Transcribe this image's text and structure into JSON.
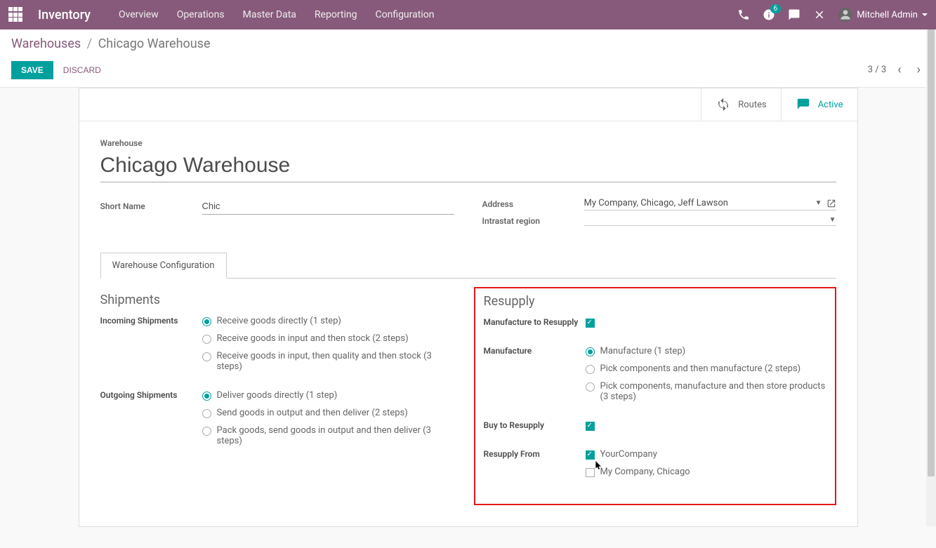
{
  "topbar": {
    "brand": "Inventory",
    "menu": [
      "Overview",
      "Operations",
      "Master Data",
      "Reporting",
      "Configuration"
    ],
    "notif_badge": "6",
    "user": "Mitchell Admin"
  },
  "breadcrumb": {
    "root": "Warehouses",
    "current": "Chicago Warehouse"
  },
  "buttons": {
    "save": "SAVE",
    "discard": "DISCARD"
  },
  "pager": {
    "text": "3 / 3"
  },
  "stat": {
    "routes": "Routes",
    "active": "Active"
  },
  "form": {
    "wh_label": "Warehouse",
    "wh_name": "Chicago Warehouse",
    "short_name_label": "Short Name",
    "short_name": "Chic",
    "address_label": "Address",
    "address": "My Company, Chicago, Jeff Lawson",
    "intrastat_label": "Intrastat region",
    "intrastat": ""
  },
  "tabs": {
    "config": "Warehouse Configuration"
  },
  "shipments": {
    "title": "Shipments",
    "incoming_label": "Incoming Shipments",
    "incoming": [
      {
        "label": "Receive goods directly (1 step)",
        "checked": true
      },
      {
        "label": "Receive goods in input and then stock (2 steps)",
        "checked": false
      },
      {
        "label": "Receive goods in input, then quality and then stock (3 steps)",
        "checked": false
      }
    ],
    "outgoing_label": "Outgoing Shipments",
    "outgoing": [
      {
        "label": "Deliver goods directly (1 step)",
        "checked": true
      },
      {
        "label": "Send goods in output and then deliver (2 steps)",
        "checked": false
      },
      {
        "label": "Pack goods, send goods in output and then deliver (3 steps)",
        "checked": false
      }
    ]
  },
  "resupply": {
    "title": "Resupply",
    "mfg_to_resupply_label": "Manufacture to Resupply",
    "mfg_to_resupply": true,
    "mfg_label": "Manufacture",
    "mfg": [
      {
        "label": "Manufacture (1 step)",
        "checked": true
      },
      {
        "label": "Pick components and then manufacture (2 steps)",
        "checked": false
      },
      {
        "label": "Pick components, manufacture and then store products (3 steps)",
        "checked": false
      }
    ],
    "buy_label": "Buy to Resupply",
    "buy": true,
    "resupply_from_label": "Resupply From",
    "resupply_from": [
      {
        "label": "YourCompany",
        "checked": true
      },
      {
        "label": "My Company, Chicago",
        "checked": false
      }
    ]
  }
}
